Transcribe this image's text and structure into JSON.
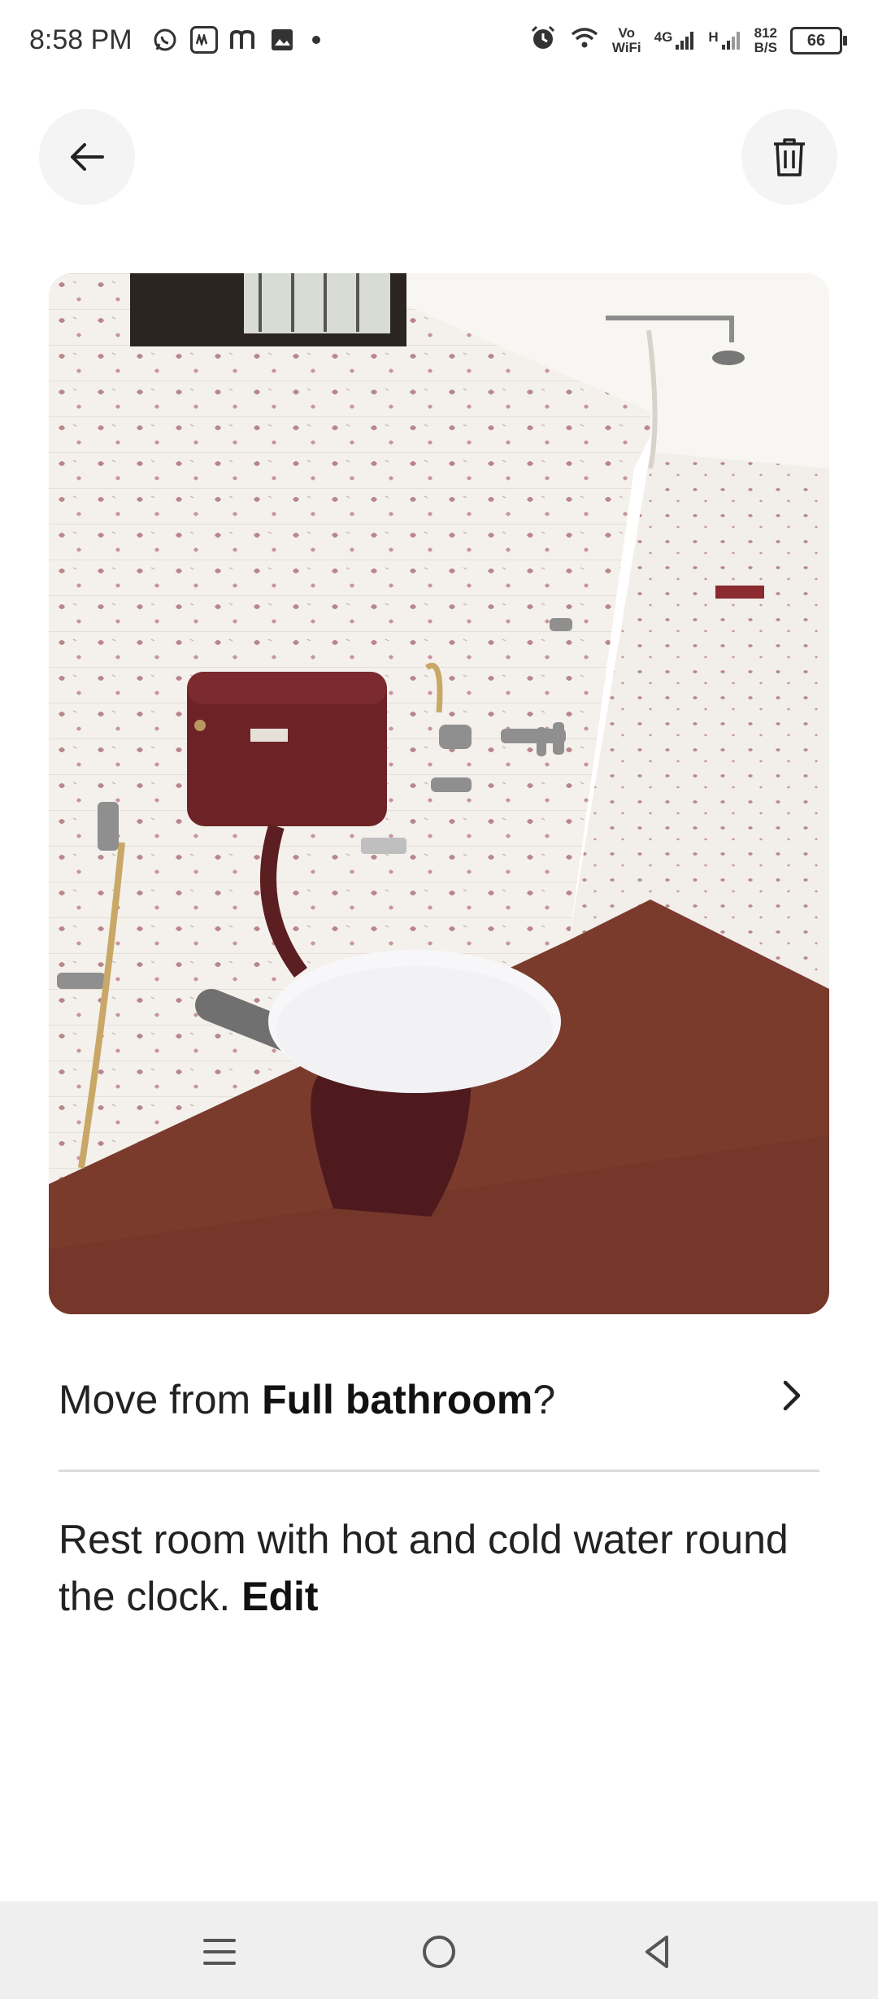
{
  "status_bar": {
    "time": "8:58 PM",
    "left_icons": [
      "whatsapp-icon",
      "paytm-icon",
      "m-icon",
      "gallery-icon",
      "dot-icon"
    ],
    "network": {
      "vowifi_top": "Vo",
      "vowifi_bottom": "WiFi",
      "lte_label": "4G",
      "h_label": "H",
      "speed_value": "812",
      "speed_unit": "B/S"
    },
    "battery_level": "66"
  },
  "header": {
    "back_icon": "arrow-left-icon",
    "delete_icon": "trash-icon"
  },
  "photo": {
    "subject": "bathroom with toilet and taps"
  },
  "move_row": {
    "prefix": "Move from ",
    "room": "Full bathroom",
    "suffix": "?"
  },
  "caption": {
    "text": "Rest room with hot and cold water round the clock.",
    "edit_label": "Edit"
  },
  "nav": {
    "menu_icon": "menu-icon",
    "home_icon": "home-circle-icon",
    "back_icon": "back-triangle-icon"
  },
  "colors": {
    "accent_text": "#222222",
    "button_bg": "#f4f4f4",
    "divider": "#dcdcdc",
    "nav_bg": "#efefef"
  }
}
